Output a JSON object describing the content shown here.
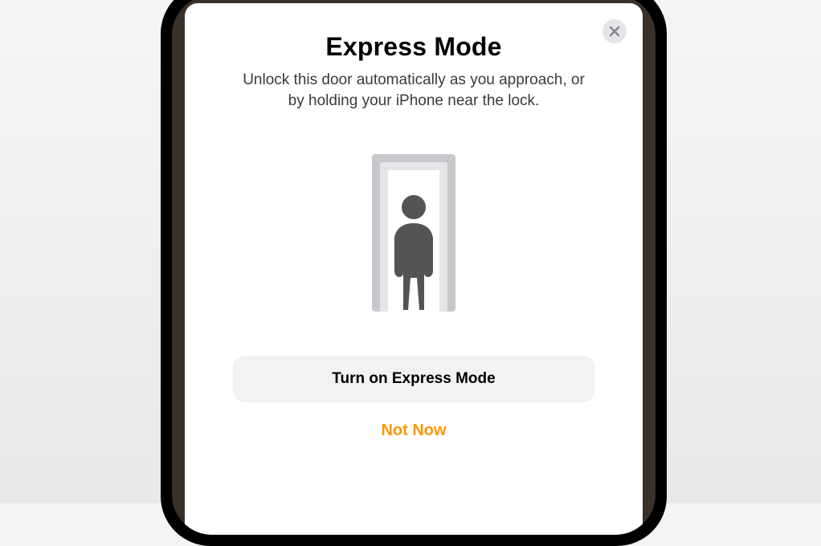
{
  "modal": {
    "title": "Express Mode",
    "description": "Unlock this door automatically as you approach, or by holding your iPhone near the lock.",
    "primaryButton": "Turn on Express Mode",
    "secondaryButton": "Not Now"
  }
}
